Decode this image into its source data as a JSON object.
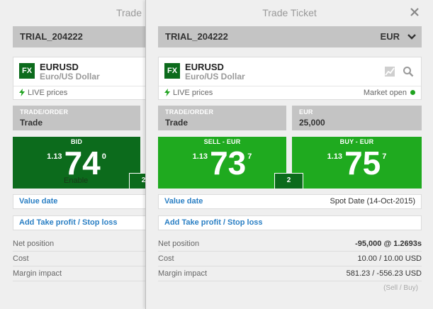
{
  "back_panel": {
    "title": "Trade",
    "account": "TRIAL_204222",
    "instrument": {
      "badge": "FX",
      "symbol": "EURUSD",
      "name": "Euro/US Dollar",
      "live": "LIVE prices"
    },
    "trade_order": {
      "label": "TRADE/ORDER",
      "value": "Trade"
    },
    "bid": {
      "label": "BID",
      "prefix": "1.13",
      "big": "74",
      "fraction": "0",
      "enable": "Enable"
    },
    "spread": "2",
    "value_date_label": "Value date",
    "tp_sl_label": "Add Take profit / Stop loss",
    "info": {
      "net_position": "Net position",
      "cost": "Cost",
      "margin_impact": "Margin impact"
    }
  },
  "front_panel": {
    "title": "Trade Ticket",
    "account": "TRIAL_204222",
    "account_currency": "EUR",
    "instrument": {
      "badge": "FX",
      "symbol": "EURUSD",
      "name": "Euro/US Dollar",
      "live": "LIVE prices",
      "market_status": "Market open"
    },
    "trade_order": {
      "label": "TRADE/ORDER",
      "value": "Trade"
    },
    "amount": {
      "label": "EUR",
      "value": "25,000"
    },
    "sell": {
      "label": "SELL - EUR",
      "prefix": "1.13",
      "big": "73",
      "fraction": "7"
    },
    "buy": {
      "label": "BUY - EUR",
      "prefix": "1.13",
      "big": "75",
      "fraction": "7"
    },
    "spread": "2",
    "value_date": {
      "label": "Value date",
      "value": "Spot Date (14-Oct-2015)"
    },
    "tp_sl_label": "Add Take profit / Stop loss",
    "info": {
      "net_position": {
        "label": "Net position",
        "value": "-95,000 @ 1.2693s"
      },
      "cost": {
        "label": "Cost",
        "value": "10.00 / 10.00 USD"
      },
      "margin_impact": {
        "label": "Margin impact",
        "value": "581.23 / -556.23 USD"
      }
    },
    "footnote": "(Sell / Buy)"
  },
  "colors": {
    "dark_green": "#0c6b1c",
    "bright_green": "#1faa1f",
    "link_blue": "#2a7fc4",
    "header_grey": "#c4c4c4"
  }
}
